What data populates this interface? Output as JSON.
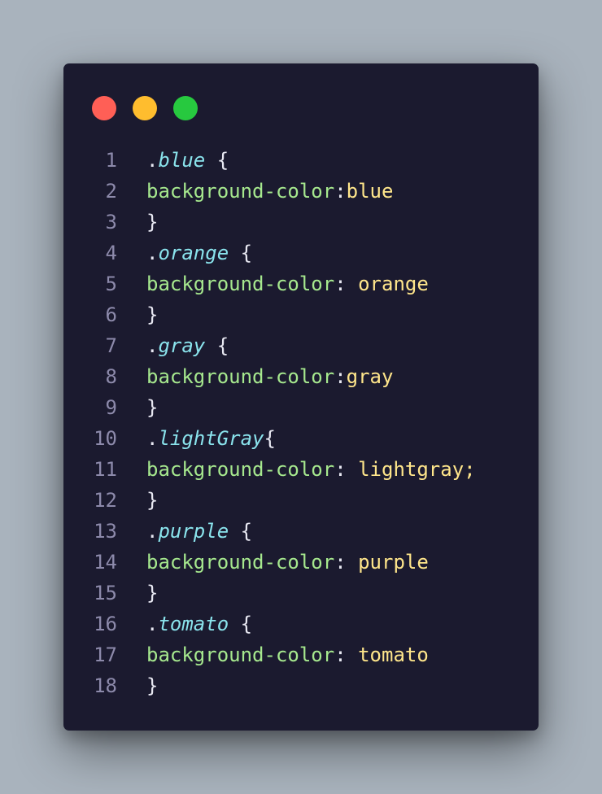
{
  "window": {
    "controls": [
      {
        "name": "close",
        "color": "#ff5f56"
      },
      {
        "name": "minimize",
        "color": "#ffbd2e"
      },
      {
        "name": "maximize",
        "color": "#27c93f"
      }
    ]
  },
  "code": {
    "language": "css",
    "lines": [
      {
        "num": "1",
        "selector": "blue",
        "after": " {"
      },
      {
        "num": "2",
        "prop": "background-color",
        "sep": ":",
        "value": "blue"
      },
      {
        "num": "3",
        "brace": "}"
      },
      {
        "num": "4",
        "selector": "orange",
        "after": " {"
      },
      {
        "num": "5",
        "prop": "background-color",
        "sep": ": ",
        "value": "orange"
      },
      {
        "num": "6",
        "brace": "}"
      },
      {
        "num": "7",
        "selector": "gray",
        "after": " {"
      },
      {
        "num": "8",
        "prop": "background-color",
        "sep": ":",
        "value": "gray"
      },
      {
        "num": "9",
        "brace": "}"
      },
      {
        "num": "10",
        "selector": "lightGray",
        "after": "{"
      },
      {
        "num": "11",
        "prop": "background-color",
        "sep": ": ",
        "value": "lightgray;"
      },
      {
        "num": "12",
        "brace": "}"
      },
      {
        "num": "13",
        "selector": "purple",
        "after": " {"
      },
      {
        "num": "14",
        "prop": "background-color",
        "sep": ": ",
        "value": "purple"
      },
      {
        "num": "15",
        "brace": "}"
      },
      {
        "num": "16",
        "selector": "tomato",
        "after": " {"
      },
      {
        "num": "17",
        "prop": "background-color",
        "sep": ": ",
        "value": "tomato"
      },
      {
        "num": "18",
        "brace": "}"
      }
    ]
  }
}
